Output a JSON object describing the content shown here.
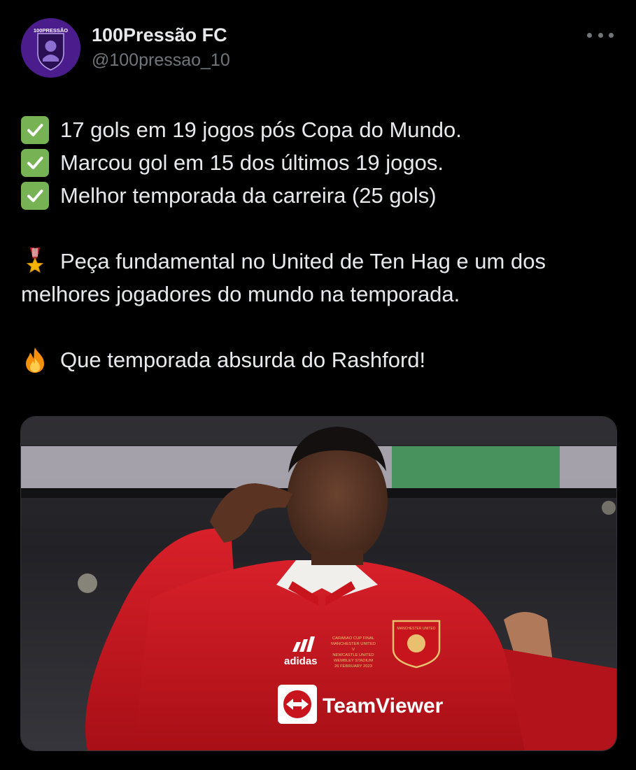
{
  "author": {
    "display_name": "100Pressão FC",
    "handle": "@100pressao_10",
    "avatar_text": "100PRESSÃO"
  },
  "more_icon": "more-horizontal-icon",
  "body": {
    "checklist": [
      {
        "icon": "check-mark-button-emoji",
        "text": "17 gols em 19 jogos pós Copa do Mundo."
      },
      {
        "icon": "check-mark-button-emoji",
        "text": "Marcou gol em 15 dos últimos 19 jogos."
      },
      {
        "icon": "check-mark-button-emoji",
        "text": "Melhor temporada da carreira (25 gols)"
      }
    ],
    "medal_paragraph": {
      "icon": "military-medal-emoji",
      "text": "Peça fundamental no United de Ten Hag e um dos melhores jogadores do mundo na temporada."
    },
    "fire_paragraph": {
      "icon": "fire-emoji",
      "text": "Que temporada absurda do Rashford!"
    }
  },
  "media": {
    "kit_text": {
      "brand": "adidas",
      "sponsor": "TeamViewer",
      "crest": "MANCHESTER UNITED",
      "match_lines": [
        "CARABAO CUP FINAL",
        "MANCHESTER UNITED",
        "V",
        "NEWCASTLE UNITED",
        "WEMBLEY STADIUM",
        "26 FEBRUARY 2023"
      ]
    },
    "colors": {
      "shirt_red": "#c8141c",
      "background_dark": "#1a1a1c",
      "check_green": "#77b255",
      "muted_text": "#71767b",
      "text": "#e7e9ea"
    }
  }
}
